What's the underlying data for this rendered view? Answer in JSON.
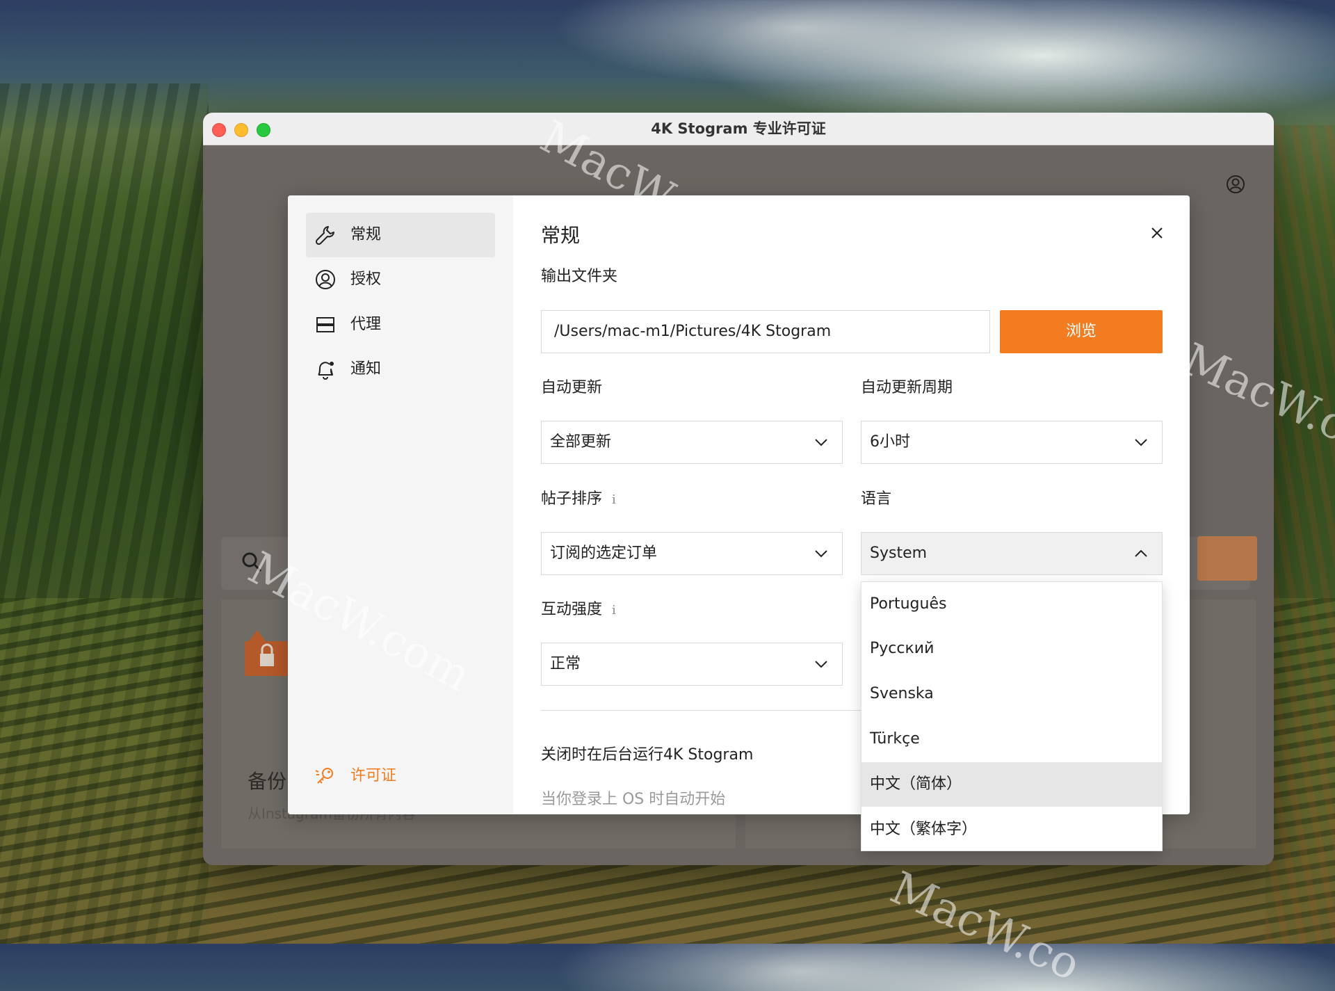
{
  "window": {
    "title": "4K Stogram 专业许可证"
  },
  "background_ui": {
    "card_title": "备份",
    "card_subtitle": "从Instagram备份所有内容"
  },
  "sidebar": {
    "items": [
      {
        "label": "常规",
        "icon": "wrench-icon",
        "active": true
      },
      {
        "label": "授权",
        "icon": "user-circle-icon",
        "active": false
      },
      {
        "label": "代理",
        "icon": "server-icon",
        "active": false
      },
      {
        "label": "通知",
        "icon": "bell-icon",
        "active": false
      }
    ],
    "license_label": "许可证"
  },
  "settings": {
    "title": "常规",
    "output_folder": {
      "label": "输出文件夹",
      "value": "/Users/mac-m1/Pictures/4K Stogram",
      "browse_label": "浏览"
    },
    "auto_update": {
      "label": "自动更新",
      "value": "全部更新"
    },
    "update_period": {
      "label": "自动更新周期",
      "value": "6小时"
    },
    "post_order": {
      "label": "帖子排序",
      "info": "i",
      "value": "订阅的选定订单"
    },
    "language": {
      "label": "语言",
      "value": "System"
    },
    "interaction": {
      "label": "互动强度",
      "info": "i",
      "value": "正常"
    },
    "run_background_label": "关闭时在后台运行4K Stogram",
    "autostart_label": "当你登录上 OS 时自动开始"
  },
  "language_dropdown": {
    "options": [
      "Português",
      "Русский",
      "Svenska",
      "Türkçe",
      "中文（简体）",
      "中文（繁体字）"
    ],
    "selected_index": 4
  },
  "watermarks": [
    "MacW.com",
    "MacW.c",
    "MacW.com",
    "MacW.co"
  ],
  "colors": {
    "accent": "#f37c21",
    "sidebar_bg": "#f5f5f5",
    "active_nav_bg": "#e7e7e7",
    "text": "#222222",
    "muted_text": "#9a9a9a"
  }
}
